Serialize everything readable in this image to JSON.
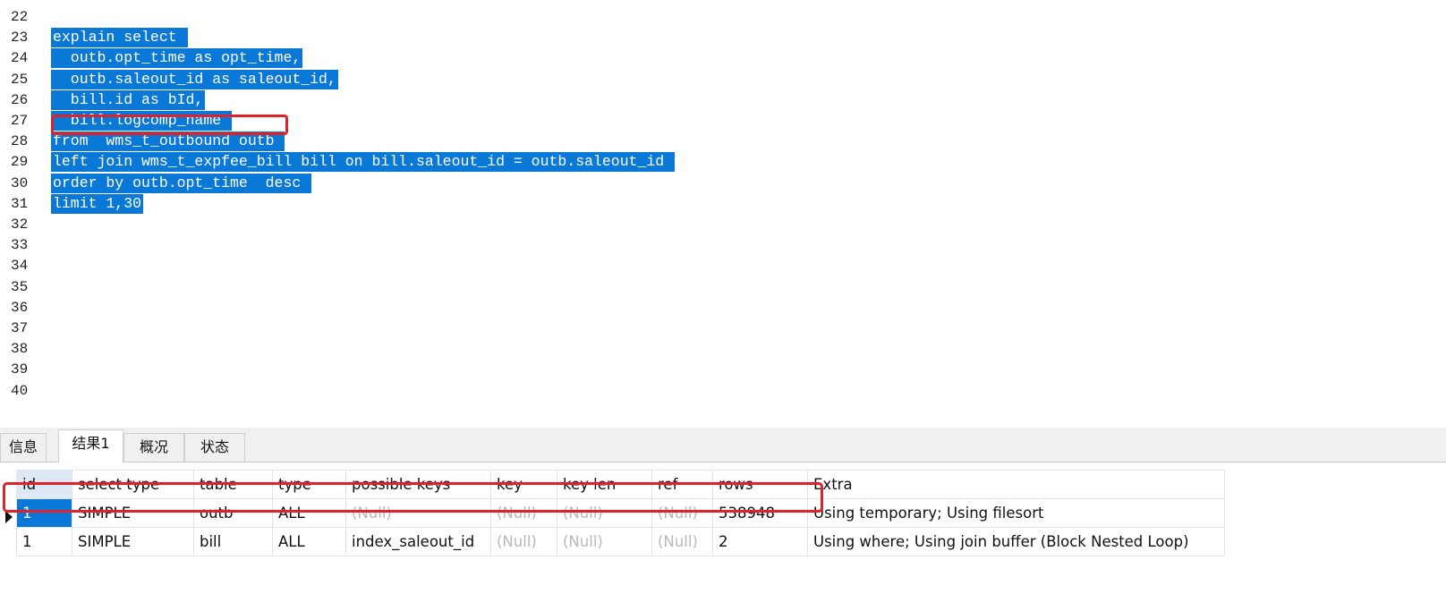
{
  "editor": {
    "lines": [
      {
        "num": "22",
        "code": ""
      },
      {
        "num": "23",
        "code": "explain select "
      },
      {
        "num": "24",
        "code": "  outb.opt_time as opt_time,"
      },
      {
        "num": "25",
        "code": "  outb.saleout_id as saleout_id,"
      },
      {
        "num": "26",
        "code": "  bill.id as bId,"
      },
      {
        "num": "27",
        "code": "  bill.logcomp_name "
      },
      {
        "num": "28",
        "code": "from  wms_t_outbound outb "
      },
      {
        "num": "29",
        "code": "left join wms_t_expfee_bill bill on bill.saleout_id = outb.saleout_id "
      },
      {
        "num": "30",
        "code": "order by outb.opt_time  desc "
      },
      {
        "num": "31",
        "code": "limit 1,30"
      },
      {
        "num": "32",
        "code": ""
      },
      {
        "num": "33",
        "code": ""
      },
      {
        "num": "34",
        "code": ""
      },
      {
        "num": "35",
        "code": ""
      },
      {
        "num": "36",
        "code": ""
      },
      {
        "num": "37",
        "code": ""
      },
      {
        "num": "38",
        "code": ""
      },
      {
        "num": "39",
        "code": ""
      },
      {
        "num": "40",
        "code": ""
      }
    ]
  },
  "tabs": [
    {
      "label": "信息",
      "active": false
    },
    {
      "label": "结果1",
      "active": true
    },
    {
      "label": "概况",
      "active": false
    },
    {
      "label": "状态",
      "active": false
    }
  ],
  "results": {
    "columns": [
      "id",
      "select type",
      "table",
      "type",
      "possible keys",
      "key",
      "key len",
      "ref",
      "rows",
      "Extra"
    ],
    "rows": [
      [
        "1",
        "SIMPLE",
        "outb",
        "ALL",
        "(Null)",
        "(Null)",
        "(Null)",
        "(Null)",
        "538948",
        "Using temporary; Using filesort"
      ],
      [
        "1",
        "SIMPLE",
        "bill",
        "ALL",
        "index_saleout_id",
        "(Null)",
        "(Null)",
        "(Null)",
        "2",
        "Using where; Using join buffer (Block Nested Loop)"
      ]
    ]
  },
  "colors": {
    "selection": "#0a78d7",
    "highlight_box": "#e0202a",
    "null_text": "#b9b9b9"
  }
}
